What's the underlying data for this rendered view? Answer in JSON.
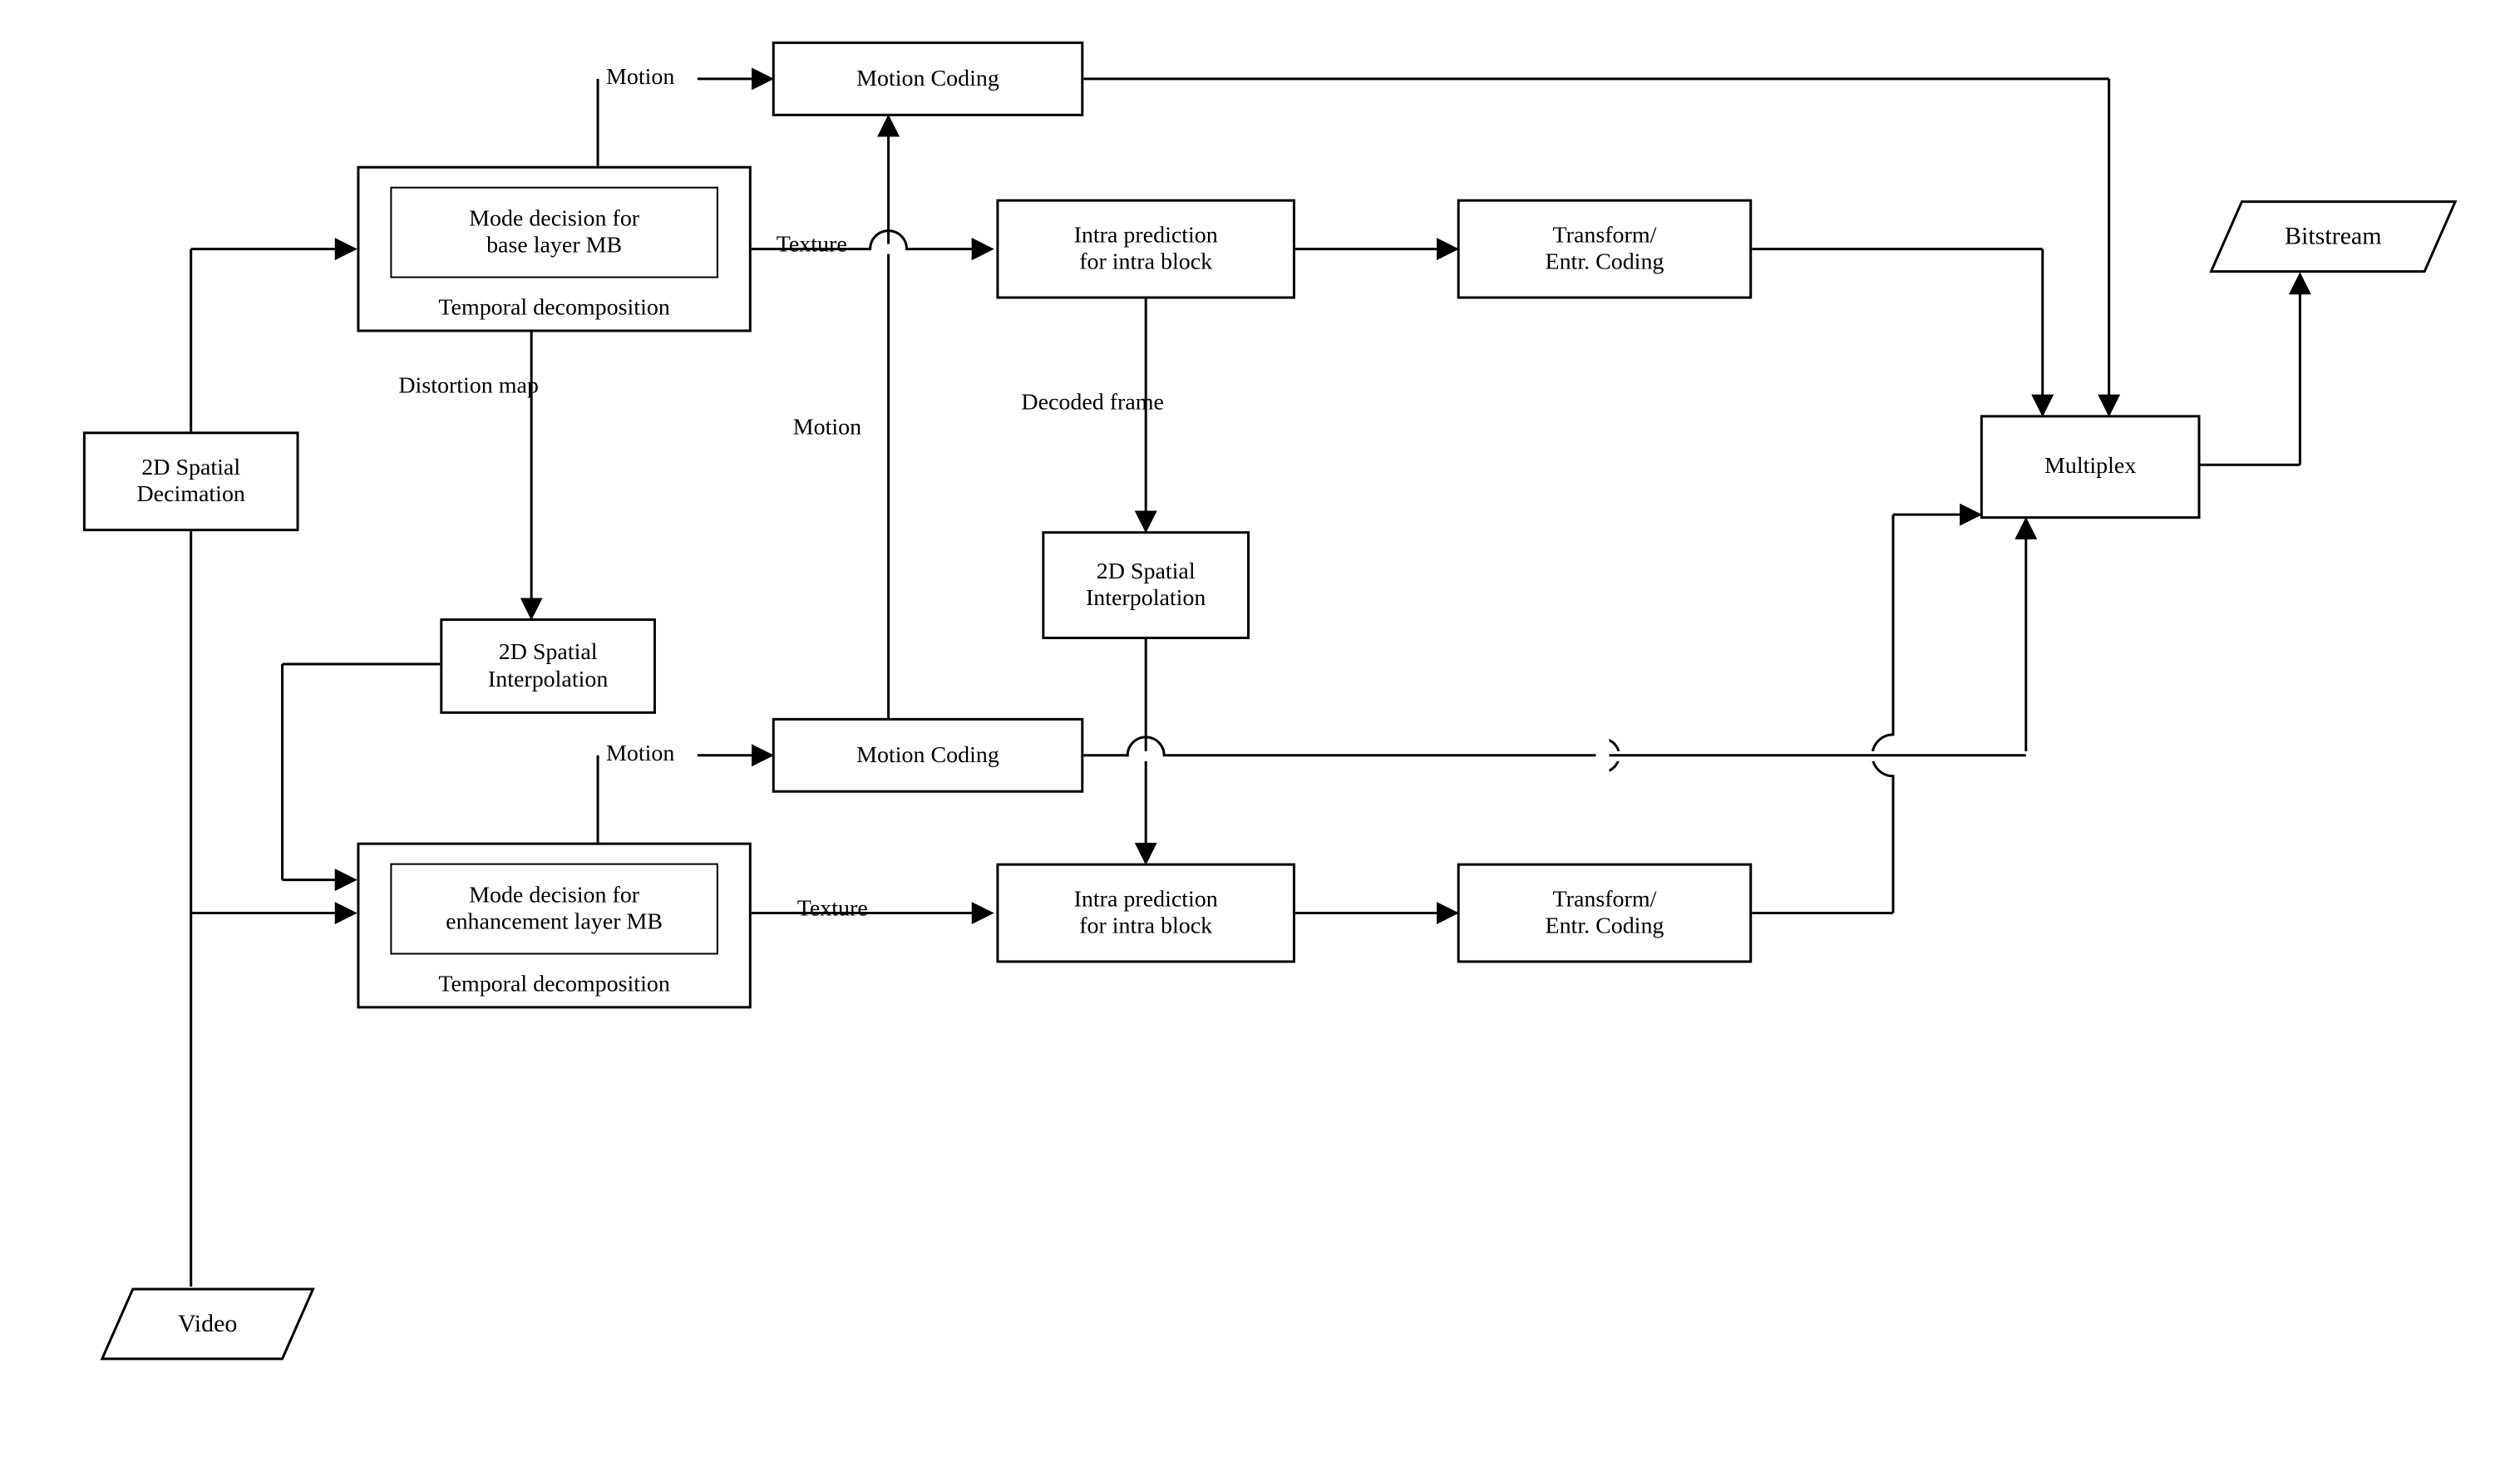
{
  "io": {
    "video": "Video",
    "bitstream": "Bitstream"
  },
  "blocks": {
    "spatial_decimation": "2D Spatial\nDecimation",
    "temporal_decomp_base": "Temporal decomposition",
    "mode_base": "Mode decision for\nbase layer MB",
    "temporal_decomp_enh": "Temporal decomposition",
    "mode_enh": "Mode decision for\nenhancement layer MB",
    "spatial_interp_base": "2D Spatial\nInterpolation",
    "spatial_interp_dec": "2D Spatial\nInterpolation",
    "motion_coding_top": "Motion Coding",
    "motion_coding_bot": "Motion Coding",
    "intra_top": "Intra prediction\nfor intra block",
    "intra_bot": "Intra prediction\nfor intra block",
    "xform_top": "Transform/\nEntr. Coding",
    "xform_bot": "Transform/\nEntr. Coding",
    "multiplex": "Multiplex"
  },
  "edge_labels": {
    "motion1": "Motion",
    "motion2": "Motion",
    "motion_mid": "Motion",
    "texture_top": "Texture",
    "texture_bot": "Texture",
    "distortion_map": "Distortion map",
    "decoded_frame": "Decoded frame"
  }
}
